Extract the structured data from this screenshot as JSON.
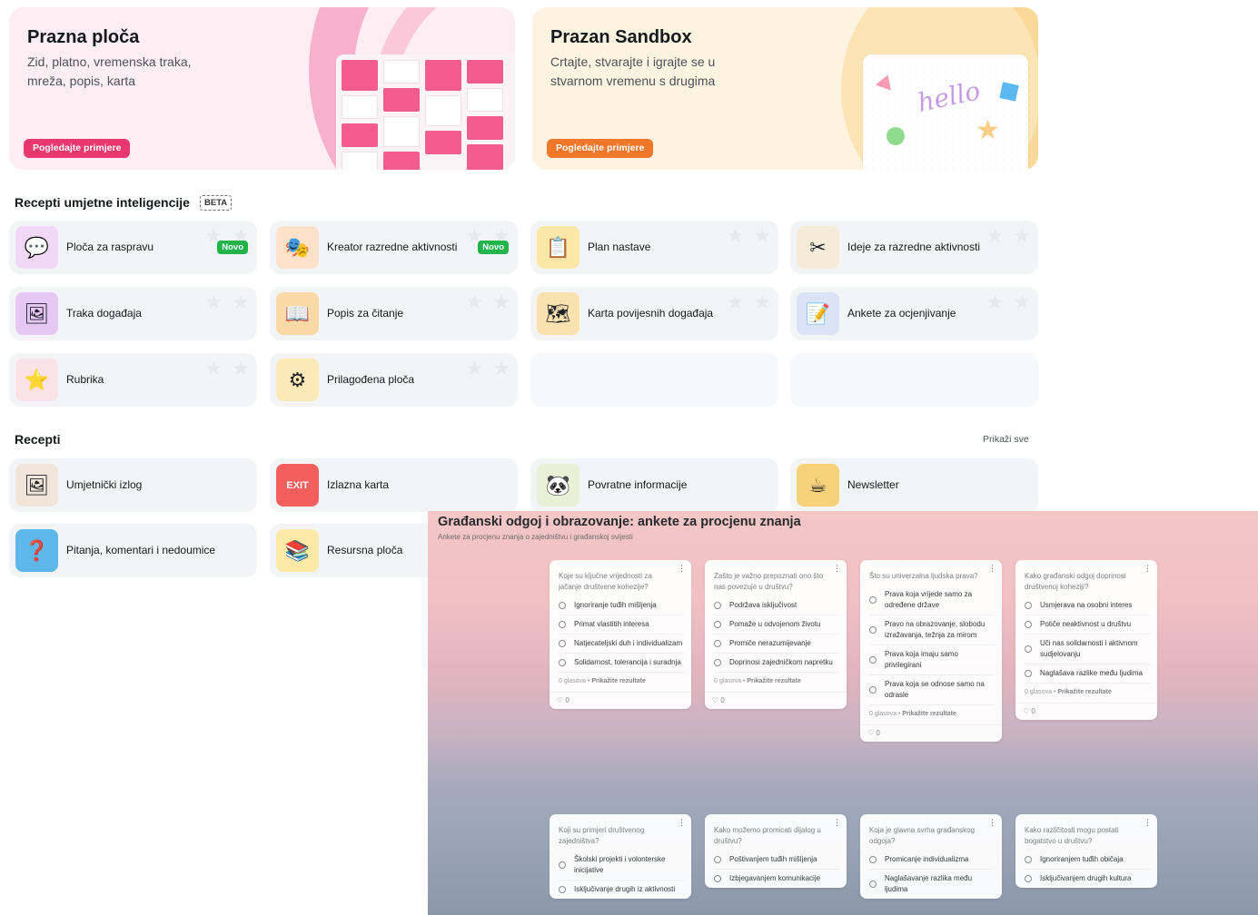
{
  "hero": {
    "blank_board": {
      "title": "Prazna ploča",
      "subtitle": "Zid, platno, vremenska traka, mreža, popis, karta",
      "button": "Pogledajte primjere"
    },
    "sandbox": {
      "title": "Prazan Sandbox",
      "subtitle": "Crtajte, stvarajte i igrajte se u stvarnom vremenu s drugima",
      "button": "Pogledajte primjere",
      "doodle_text": "hello"
    }
  },
  "ai_recipes": {
    "title": "Recepti umjetne inteligencije",
    "badge": "BETA",
    "items": [
      {
        "label": "Ploča za raspravu",
        "badge": "Novo",
        "icon": "discussion-icon"
      },
      {
        "label": "Kreator razredne aktivnosti",
        "badge": "Novo",
        "icon": "theater-masks-icon"
      },
      {
        "label": "Plan nastave",
        "badge": "",
        "icon": "lesson-plan-icon"
      },
      {
        "label": "Ideje za razredne aktivnosti",
        "badge": "",
        "icon": "craft-tools-icon"
      },
      {
        "label": "Traka događaja",
        "badge": "",
        "icon": "timeline-icon"
      },
      {
        "label": "Popis za čitanje",
        "badge": "",
        "icon": "reading-list-icon"
      },
      {
        "label": "Karta povijesnih događaja",
        "badge": "",
        "icon": "map-icon"
      },
      {
        "label": "Ankete za ocjenjivanje",
        "badge": "",
        "icon": "quiz-icon"
      },
      {
        "label": "Rubrika",
        "badge": "",
        "icon": "rubric-icon"
      },
      {
        "label": "Prilagođena ploča",
        "badge": "",
        "icon": "custom-board-icon"
      }
    ]
  },
  "recipes": {
    "title": "Recepti",
    "see_all": "Prikaži sve",
    "items": [
      {
        "label": "Umjetnički izlog",
        "icon": "gallery-icon"
      },
      {
        "label": "Izlazna karta",
        "icon": "exit-sign-icon"
      },
      {
        "label": "Povratne informacije",
        "icon": "feedback-animals-icon"
      },
      {
        "label": "Newsletter",
        "icon": "newsletter-icon"
      },
      {
        "label": "Pitanja, komentari i nedoumice",
        "icon": "questions-icon"
      },
      {
        "label": "Resursna ploča",
        "icon": "resources-icon"
      }
    ]
  },
  "preview": {
    "title": "Građanski odgoj i obrazovanje: ankete za procjenu znanja",
    "subtitle": "Ankete za procjenu znanja o zajedništvu i građanskoj svijesti",
    "votes": "0 glasova",
    "show_results": "Prikažite rezultate",
    "likes": "0",
    "cards": [
      {
        "question": "Koje su ključne vrijednosti za jačanje društvene kohezije?",
        "options": [
          "Ignoriranje tuđih mišljenja",
          "Primat vlastitih interesa",
          "Natjecateljski duh i individualizam",
          "Solidarnost, tolerancija i suradnja"
        ]
      },
      {
        "question": "Zašto je važno prepoznati ono što nas povezuje u društvu?",
        "options": [
          "Podržava isključivost",
          "Pomaže u odvojenom životu",
          "Promiče nerazumijevanje",
          "Doprinosi zajedničkom napretku"
        ]
      },
      {
        "question": "Što su univerzalna ljudska prava?",
        "options": [
          "Prava koja vrijede samo za određene države",
          "Pravo na obrazovanje, slobodu izražavanja, težnja za mirom",
          "Prava koja imaju samo privilegirani",
          "Prava koja se odnose samo na odrasle"
        ]
      },
      {
        "question": "Kako građanski odgoj doprinosi društvenoj koheziji?",
        "options": [
          "Usmjerava na osobni interes",
          "Potiče neaktivnost u društvu",
          "Uči nas solidarnosti i aktivnom sudjelovanju",
          "Naglašava razlike među ljudima"
        ]
      },
      {
        "question": "Koji su primjeri društvenog zajedništva?",
        "options": [
          "Školski projekti i volonterske inicijative",
          "Isključivanje drugih iz aktivnosti"
        ]
      },
      {
        "question": "Kako možemo promicati dijalog u društvu?",
        "options": [
          "Poštivanjem tuđih mišljenja",
          "Izbjegavanjem komunikacije"
        ]
      },
      {
        "question": "Koja je glavna svrha građanskog odgoja?",
        "options": [
          "Promicanje individualizma",
          "Naglašavanje razlika među ljudima"
        ]
      },
      {
        "question": "Kako različitosti mogu postati bogatstvo u društvu?",
        "options": [
          "Ignoriranjem tuđih običaja",
          "Isključivanjem drugih kultura"
        ]
      }
    ]
  }
}
